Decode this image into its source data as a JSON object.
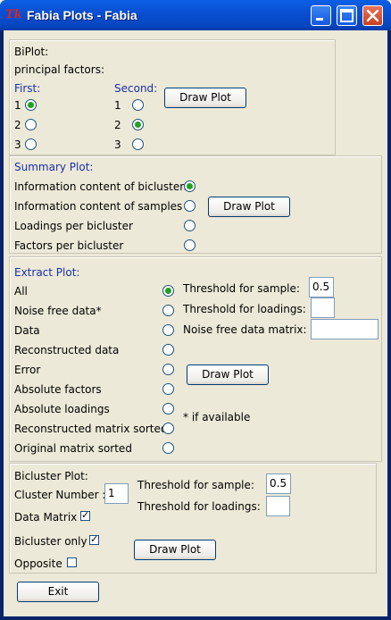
{
  "window": {
    "title": "Fabia Plots - Fabia",
    "icon": "Tk"
  },
  "biplot": {
    "title": "BiPlot:",
    "principal_label": "principal factors:",
    "first_label": "First:",
    "second_label": "Second:",
    "first_options": [
      "1",
      "2",
      "3"
    ],
    "second_options": [
      "1",
      "2",
      "3"
    ],
    "first_selected": "1",
    "second_selected": "2",
    "draw_button": "Draw Plot"
  },
  "summary": {
    "title": "Summary Plot:",
    "options": [
      "Information content of biclusters",
      "Information content of samples",
      "Loadings per bicluster",
      "Factors per bicluster"
    ],
    "selected_index": 0,
    "draw_button": "Draw Plot"
  },
  "extract": {
    "title": "Extract Plot:",
    "options": [
      "All",
      "Noise free data*",
      "Data",
      "Reconstructed data",
      "Error",
      "Absolute factors",
      "Absolute loadings",
      "Reconstructed matrix sorted",
      "Original matrix sorted"
    ],
    "selected_index": 0,
    "threshold_sample_label": "Threshold for sample:",
    "threshold_sample_value": "0.5",
    "threshold_loadings_label": "Threshold for loadings:",
    "threshold_loadings_value": "",
    "noise_free_label": "Noise free data matrix:",
    "noise_free_value": "",
    "draw_button": "Draw Plot",
    "footnote": "* if available"
  },
  "bicluster": {
    "title": "Bicluster Plot:",
    "cluster_number_label": "Cluster Number :",
    "cluster_number_value": "1",
    "data_matrix_label": "Data Matrix",
    "data_matrix_checked": true,
    "bicluster_only_label": "Bicluster only",
    "bicluster_only_checked": true,
    "opposite_label": "Opposite",
    "opposite_checked": false,
    "threshold_sample_label": "Threshold for sample:",
    "threshold_sample_value": "0.5",
    "threshold_loadings_label": "Threshold for loadings:",
    "threshold_loadings_value": "",
    "draw_button": "Draw Plot"
  },
  "exit_button": "Exit",
  "colors": {
    "titlebar": "#0A50D2",
    "panel": "#ECE9D8",
    "label_blue": "#1A2FA8",
    "radio_on": "#21A121"
  }
}
